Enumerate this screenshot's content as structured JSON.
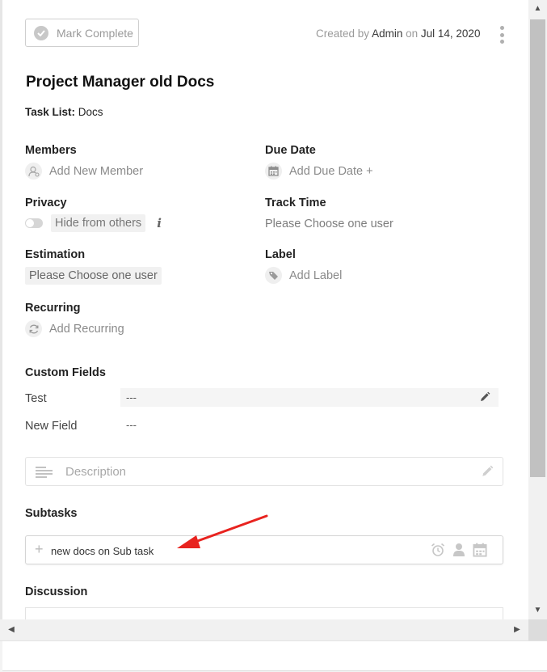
{
  "header": {
    "mark_complete_label": "Mark Complete",
    "created_prefix": "Created by",
    "created_by": "Admin",
    "created_on_word": "on",
    "created_date": "Jul 14, 2020"
  },
  "task": {
    "title": "Project Manager old Docs",
    "task_list_label": "Task List:",
    "task_list_value": "Docs"
  },
  "fields": {
    "members": {
      "label": "Members",
      "action": "Add New Member"
    },
    "due_date": {
      "label": "Due Date",
      "action": "Add Due Date +"
    },
    "privacy": {
      "label": "Privacy",
      "action": "Hide from others",
      "info": "i"
    },
    "track_time": {
      "label": "Track Time",
      "value": "Please Choose one user"
    },
    "estimation": {
      "label": "Estimation",
      "value": "Please Choose one user"
    },
    "label": {
      "label": "Label",
      "action": "Add Label"
    },
    "recurring": {
      "label": "Recurring",
      "action": "Add Recurring"
    }
  },
  "custom_fields": {
    "heading": "Custom Fields",
    "rows": [
      {
        "name": "Test",
        "value": "---"
      },
      {
        "name": "New Field",
        "value": "---"
      }
    ]
  },
  "description": {
    "placeholder": "Description"
  },
  "subtasks": {
    "heading": "Subtasks",
    "input_value": "new docs on Sub task"
  },
  "discussion": {
    "heading": "Discussion"
  },
  "colors": {
    "annotation_arrow": "#e8231f",
    "muted_text": "#8a8a8a",
    "icon_grey": "#b5b5b5"
  }
}
